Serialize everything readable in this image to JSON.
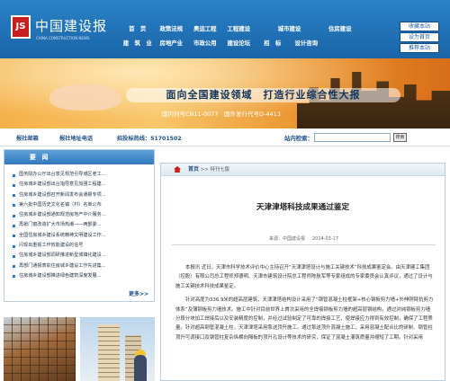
{
  "header": {
    "logo_mark": "JS",
    "site_name": "中国建设报",
    "logo_sub": "CHINA CONSTRUCTION NEWS",
    "nav_row1": [
      "首　页",
      "政策法规",
      "奥运工程",
      "工程建设",
      "城市建设",
      "住房建设"
    ],
    "nav_row2": [
      "建　筑　业",
      "房地产业",
      "市政公用",
      "建设论坛",
      "招　标",
      "设计咨询"
    ],
    "btn_favorite": "收藏本站",
    "btn_home": "设为首页",
    "btn_recommend": "推荐本站"
  },
  "banner": {
    "slogan": "面向全国建设领域　打造行业综合性大报",
    "issn": "国内刊号CN11-0077　国外发行代号D-4413"
  },
  "infobar": {
    "address_label": "报社邮箱",
    "phone_label": "报社地址电话",
    "ad_phone": "招投标热线：51701502",
    "search_label": "站内检索：",
    "search_placeholder": "",
    "search_button": "搜索"
  },
  "sidebar": {
    "title": "要　闻",
    "items": [
      "国务院办公厅出台意见规范引导城区老工...",
      "住房城乡建设部出台指导意见加强工程建...",
      "住房城乡建设部召开新闻发布会通报专项...",
      "第六批中国历史文化名镇（村）名单公布",
      "住房城乡建设部通知规范房地产中介服务...",
      "再掀门窗改造扩大市场热潮——两部委...",
      "全国住房城乡建设系统精神文明建设工作...",
      "闪现出重视工作效能建设的信号",
      "住房城乡建设部调研推进新型城镇化建设...",
      "再部门通报表彰住房城乡建设工作先进集...",
      "住房城乡建设部推进绿色建筑深度发展..."
    ],
    "more": "更多>>"
  },
  "article": {
    "crumb_home": "首页",
    "crumb_sep": ">>",
    "crumb_section": "特刊七版",
    "title": "天津津塔科技成果通过鉴定",
    "source": "来源：中国建设报",
    "date": "2014-03-17",
    "paragraphs": [
      "本报讯 近日，天津市科学技术评价中心主持召开“天津津塔设计与施工关键技术”科技成果鉴定会。由天津建工集团（控股）有限公司总工程师郑德明、天津市建筑设计院总工程师陈航军等专家组成的专家委员会认真评议，通过了设计与施工关键技术科技成果鉴定。",
      "针对高度为336.9米的超高层建筑，天津津塔结构设计采用了“钢管混凝土柱框架+核心钢板剪力墙+外伸刚臂抗剪力体系”及薄钢板剪力墙技术。施工中针对目前世界上首次采用的全焊接钢板剪力墙的超高层钢结构，通过对纯钢板剪力墙分段分块加工焊接后以及安装精度的控制，并经过试验制定了可靠的焊接工艺，使焊接应力得到有效控制，确保了工程质量。针对超高钢管混凝土柱，天津津塔采用泵送顶升施工，通过泵送顶升混凝土施工，采用混凝土配合比的研制、钢管柱顶升可调接口及钢管柱复杂纵横向隔板的顶升孔设计等技术的研究，保证了混凝土灌筑质量并缩短了工期。针对采用"
    ]
  },
  "colors": {
    "header_blue": "#1a64a8",
    "link_blue": "#1d4f8a",
    "banner_orange": "#f0a040"
  }
}
